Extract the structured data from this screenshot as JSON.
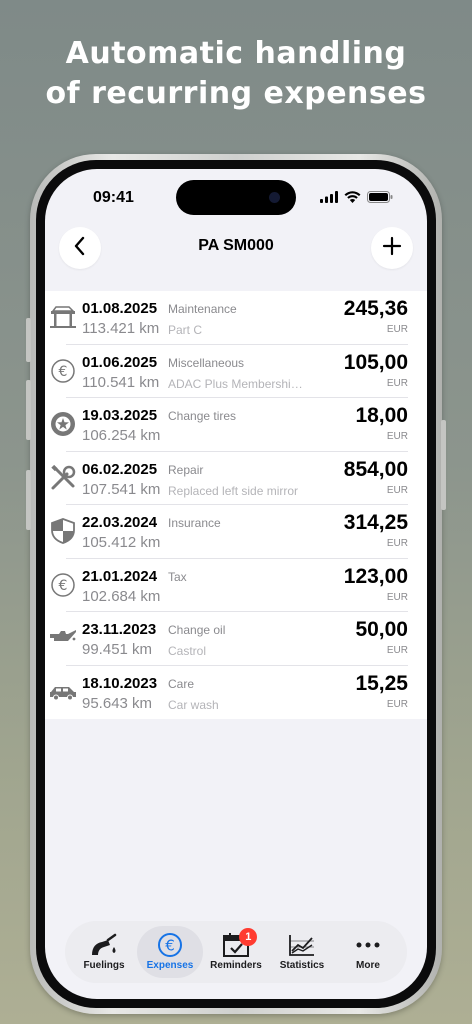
{
  "headline": {
    "line1": "Automatic handling",
    "line2": "of recurring expenses"
  },
  "status_bar": {
    "time": "09:41"
  },
  "nav": {
    "title": "PA SM000",
    "back_icon": "chevron-left-icon",
    "add_icon": "plus-icon"
  },
  "expenses": [
    {
      "icon": "car-lift-icon",
      "date": "01.08.2025",
      "category": "Maintenance",
      "odometer": "113.421 km",
      "note": "Part C",
      "amount": "245,36",
      "currency": "EUR"
    },
    {
      "icon": "euro-coin-icon",
      "date": "01.06.2025",
      "category": "Miscellaneous",
      "odometer": "110.541 km",
      "note": "ADAC Plus Membershi…",
      "amount": "105,00",
      "currency": "EUR"
    },
    {
      "icon": "tire-icon",
      "date": "19.03.2025",
      "category": "Change tires",
      "odometer": "106.254 km",
      "note": "",
      "amount": "18,00",
      "currency": "EUR"
    },
    {
      "icon": "wrench-screwdriver-icon",
      "date": "06.02.2025",
      "category": "Repair",
      "odometer": "107.541 km",
      "note": "Replaced left side mirror",
      "amount": "854,00",
      "currency": "EUR"
    },
    {
      "icon": "shield-icon",
      "date": "22.03.2024",
      "category": "Insurance",
      "odometer": "105.412 km",
      "note": "",
      "amount": "314,25",
      "currency": "EUR"
    },
    {
      "icon": "euro-coin-icon",
      "date": "21.01.2024",
      "category": "Tax",
      "odometer": "102.684 km",
      "note": "",
      "amount": "123,00",
      "currency": "EUR"
    },
    {
      "icon": "oil-can-icon",
      "date": "23.11.2023",
      "category": "Change oil",
      "odometer": "99.451 km",
      "note": "Castrol",
      "amount": "50,00",
      "currency": "EUR"
    },
    {
      "icon": "car-wash-icon",
      "date": "18.10.2023",
      "category": "Care",
      "odometer": "95.643 km",
      "note": "Car wash",
      "amount": "15,25",
      "currency": "EUR"
    }
  ],
  "tabs": [
    {
      "label": "Fuelings",
      "icon": "fuel-nozzle-icon",
      "active": false
    },
    {
      "label": "Expenses",
      "icon": "euro-circle-icon",
      "active": true
    },
    {
      "label": "Reminders",
      "icon": "calendar-check-icon",
      "active": false,
      "badge": "1"
    },
    {
      "label": "Statistics",
      "icon": "chart-icon",
      "active": false
    },
    {
      "label": "More",
      "icon": "more-dots-icon",
      "active": false
    }
  ],
  "colors": {
    "accent": "#1673e6",
    "badge": "#ff3b30",
    "secondary_text": "#8a8a8e"
  }
}
